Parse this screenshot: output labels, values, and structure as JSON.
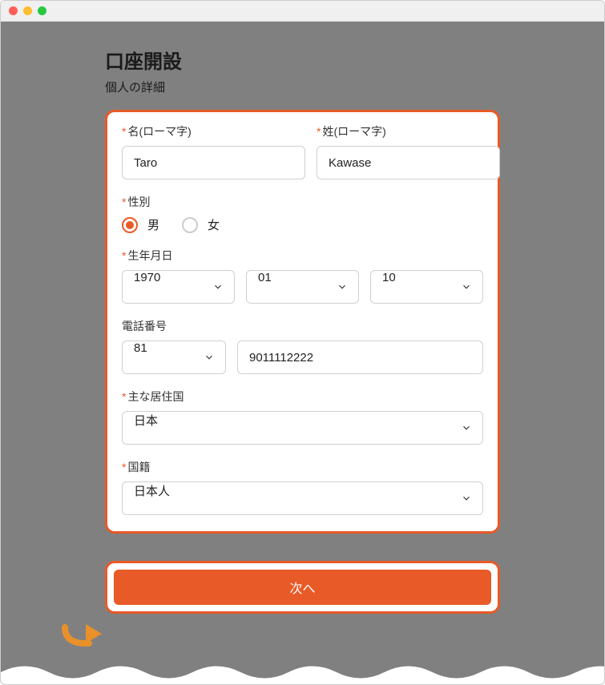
{
  "header": {
    "title": "口座開設",
    "subtitle": "個人の詳細"
  },
  "form": {
    "firstName": {
      "label": "名(ローマ字)",
      "value": "Taro",
      "required": true
    },
    "lastName": {
      "label": "姓(ローマ字)",
      "value": "Kawase",
      "required": true
    },
    "gender": {
      "label": "性別",
      "required": true,
      "options": {
        "male": "男",
        "female": "女"
      },
      "selected": "male"
    },
    "dob": {
      "label": "生年月日",
      "required": true,
      "year": "1970",
      "month": "01",
      "day": "10"
    },
    "phone": {
      "label": "電話番号",
      "required": false,
      "countryCode": "81",
      "number": "9011112222"
    },
    "residence": {
      "label": "主な居住国",
      "required": true,
      "value": "日本"
    },
    "nationality": {
      "label": "国籍",
      "required": true,
      "value": "日本人"
    }
  },
  "buttons": {
    "next": "次へ"
  }
}
